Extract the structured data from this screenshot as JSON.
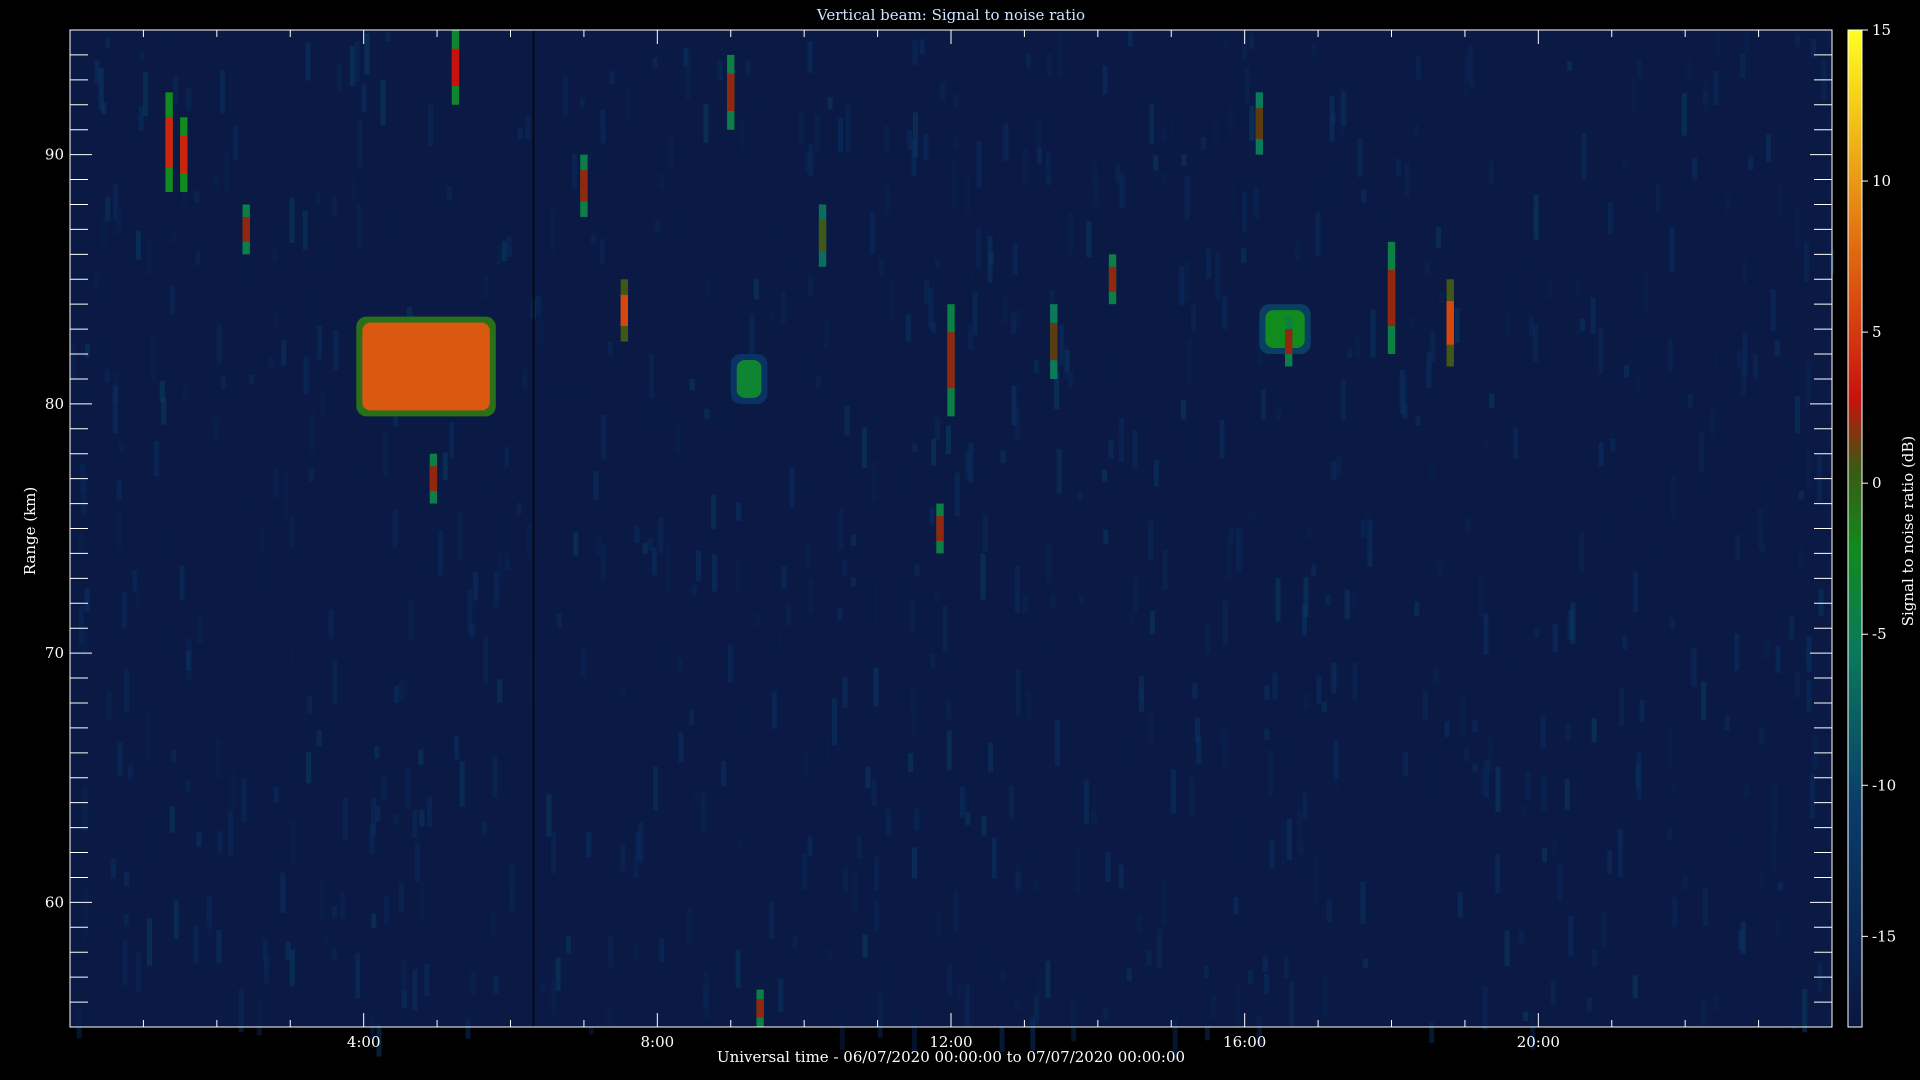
{
  "chart_data": {
    "type": "heatmap",
    "title": "Vertical beam: Signal to noise ratio",
    "xlabel": "Universal time - 06/07/2020 00:00:00 to 07/07/2020 00:00:00",
    "ylabel": "Range (km)",
    "x_ticks": [
      "4:00",
      "8:00",
      "12:00",
      "16:00",
      "20:00"
    ],
    "x_tick_hours": [
      4,
      8,
      12,
      16,
      20
    ],
    "xlim_hours": [
      0,
      24
    ],
    "y_ticks": [
      60,
      70,
      80,
      90
    ],
    "ylim_km": [
      55,
      95
    ],
    "colorbar": {
      "label": "Signal to noise ratio (dB)",
      "ticks": [
        15,
        10,
        5,
        0,
        -5,
        -10,
        -15
      ],
      "range": [
        -18,
        15
      ],
      "colormap": [
        "#0a1640",
        "#0a3c6a",
        "#0a7a5a",
        "#118a1e",
        "#c8120e",
        "#e06a10",
        "#ffff20"
      ]
    },
    "background_snr_db": -15,
    "features": [
      {
        "t_start": 3.9,
        "t_end": 5.8,
        "range_bottom": 79.5,
        "range_top": 83.5,
        "snr_db": 6
      },
      {
        "t_start": 9.0,
        "t_end": 9.5,
        "range_bottom": 80.0,
        "range_top": 82.0,
        "snr_db": -4
      },
      {
        "t_start": 16.2,
        "t_end": 16.9,
        "range_bottom": 82.0,
        "range_top": 84.0,
        "snr_db": -3
      },
      {
        "t_start": 1.3,
        "t_end": 1.4,
        "range_bottom": 88.5,
        "range_top": 92.5,
        "snr_db": 3
      },
      {
        "t_start": 1.5,
        "t_end": 1.6,
        "range_bottom": 88.5,
        "range_top": 91.5,
        "snr_db": 3
      },
      {
        "t_start": 2.35,
        "t_end": 2.45,
        "range_bottom": 86.0,
        "range_top": 88.0,
        "snr_db": 1
      },
      {
        "t_start": 5.2,
        "t_end": 5.3,
        "range_bottom": 92.0,
        "range_top": 95.0,
        "snr_db": 2
      },
      {
        "t_start": 4.9,
        "t_end": 5.0,
        "range_bottom": 76.0,
        "range_top": 78.0,
        "snr_db": 1
      },
      {
        "t_start": 6.95,
        "t_end": 7.05,
        "range_bottom": 87.5,
        "range_top": 90.0,
        "snr_db": 1
      },
      {
        "t_start": 7.5,
        "t_end": 7.6,
        "range_bottom": 82.5,
        "range_top": 85.0,
        "snr_db": 5
      },
      {
        "t_start": 8.95,
        "t_end": 9.05,
        "range_bottom": 91.0,
        "range_top": 94.0,
        "snr_db": 1
      },
      {
        "t_start": 9.35,
        "t_end": 9.45,
        "range_bottom": 55.0,
        "range_top": 56.5,
        "snr_db": 1
      },
      {
        "t_start": 10.2,
        "t_end": 10.3,
        "range_bottom": 85.5,
        "range_top": 88.0,
        "snr_db": -1
      },
      {
        "t_start": 11.8,
        "t_end": 11.9,
        "range_bottom": 74.0,
        "range_top": 76.0,
        "snr_db": 1
      },
      {
        "t_start": 11.95,
        "t_end": 12.05,
        "range_bottom": 79.5,
        "range_top": 84.0,
        "snr_db": 1
      },
      {
        "t_start": 13.35,
        "t_end": 13.45,
        "range_bottom": 81.0,
        "range_top": 84.0,
        "snr_db": 0
      },
      {
        "t_start": 14.15,
        "t_end": 14.25,
        "range_bottom": 84.0,
        "range_top": 86.0,
        "snr_db": 1
      },
      {
        "t_start": 16.15,
        "t_end": 16.25,
        "range_bottom": 90.0,
        "range_top": 92.5,
        "snr_db": 0
      },
      {
        "t_start": 16.55,
        "t_end": 16.65,
        "range_bottom": 81.5,
        "range_top": 83.5,
        "snr_db": 1
      },
      {
        "t_start": 17.95,
        "t_end": 18.05,
        "range_bottom": 82.0,
        "range_top": 86.5,
        "snr_db": 1
      },
      {
        "t_start": 18.75,
        "t_end": 18.85,
        "range_bottom": 81.5,
        "range_top": 85.0,
        "snr_db": 5
      }
    ]
  }
}
